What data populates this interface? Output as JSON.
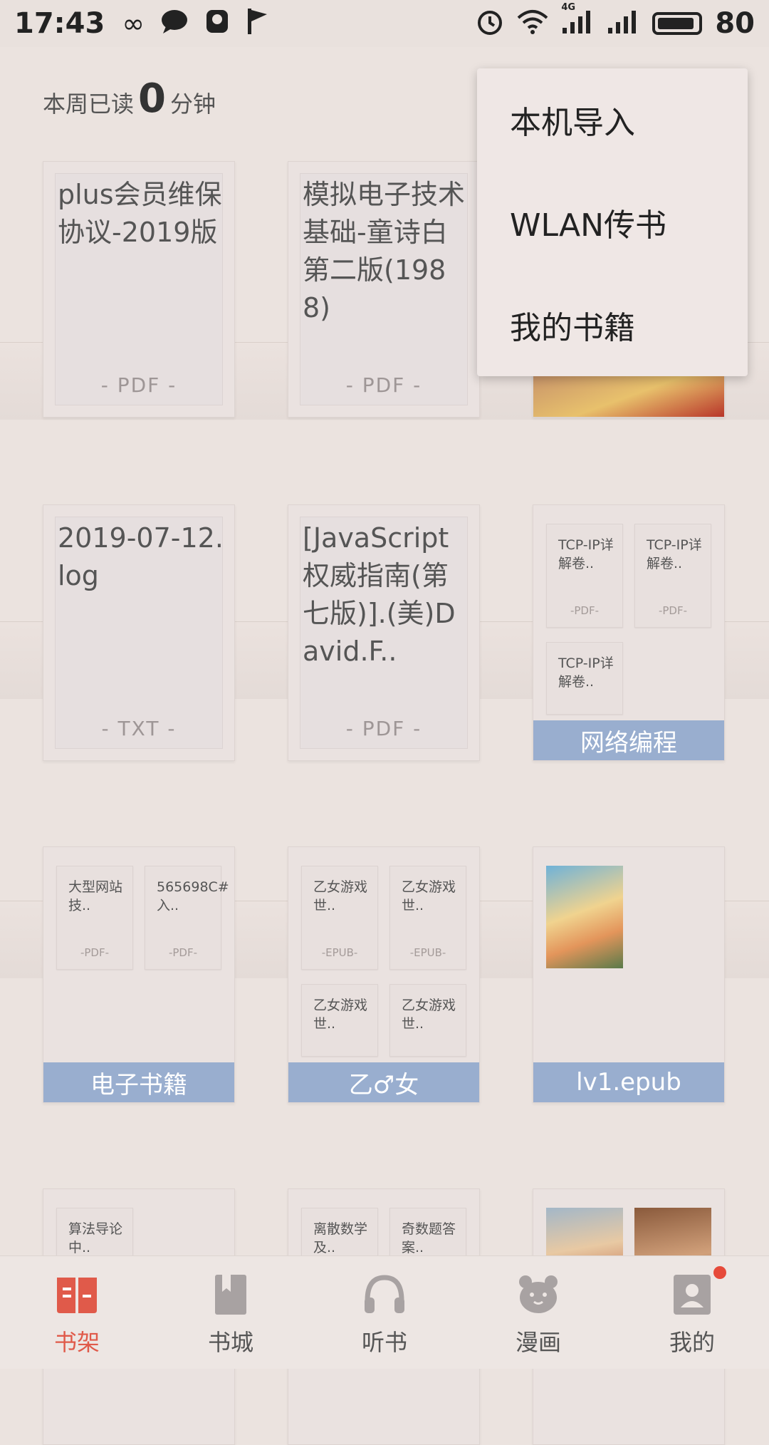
{
  "status_bar": {
    "time": "17:43",
    "network": "4G",
    "battery": "80"
  },
  "weekly": {
    "prefix": "本周已读",
    "value": "0",
    "suffix": "分钟"
  },
  "books_row1": [
    {
      "title": "plus会员维保协议-2019版",
      "type": "- PDF -"
    },
    {
      "title": "模拟电子技术基础-童诗白第二版(1988)",
      "type": "- PDF -"
    }
  ],
  "books_row2": [
    {
      "title": "2019-07-12.log",
      "type": "- TXT -"
    },
    {
      "title": "[JavaScript权威指南(第七版)].(美)David.F..",
      "type": "- PDF -"
    }
  ],
  "group_network": {
    "label": "网络编程",
    "items": [
      {
        "title": "TCP-IP详解卷..",
        "type": "-PDF-"
      },
      {
        "title": "TCP-IP详解卷..",
        "type": "-PDF-"
      },
      {
        "title": "TCP-IP详解卷..",
        "type": ""
      }
    ]
  },
  "group_ebooks": {
    "label": "电子书籍",
    "items": [
      {
        "title": "大型网站技..",
        "type": "-PDF-"
      },
      {
        "title": "565698C#入..",
        "type": "-PDF-"
      }
    ]
  },
  "group_otome": {
    "label": "乙♂女",
    "items": [
      {
        "title": "乙女游戏世..",
        "type": "-EPUB-"
      },
      {
        "title": "乙女游戏世..",
        "type": "-EPUB-"
      },
      {
        "title": "乙女游戏世..",
        "type": ""
      },
      {
        "title": "乙女游戏世..",
        "type": ""
      }
    ]
  },
  "group_lv1": {
    "label": "lv1.epub"
  },
  "row4": {
    "a": {
      "title": "算法导论中.."
    },
    "b1": {
      "title": "离散数学及.."
    },
    "b2": {
      "title": "奇数题答案.."
    }
  },
  "menu": {
    "items": [
      "本机导入",
      "WLAN传书",
      "我的书籍"
    ]
  },
  "nav": [
    {
      "label": "书架",
      "active": true
    },
    {
      "label": "书城"
    },
    {
      "label": "听书"
    },
    {
      "label": "漫画"
    },
    {
      "label": "我的"
    }
  ],
  "colors": {
    "accent": "#e05a4a",
    "group_label": "#99aecf",
    "background": "#ebe3df"
  }
}
